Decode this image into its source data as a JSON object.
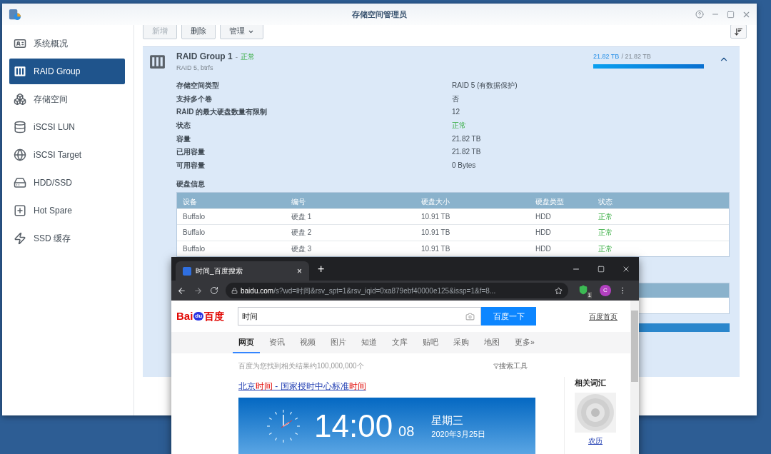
{
  "dsm_window": {
    "title": "存储空间管理员"
  },
  "sidebar": {
    "items": [
      {
        "label": "系统概况",
        "selected": false
      },
      {
        "label": "RAID Group",
        "selected": true
      },
      {
        "label": "存储空间",
        "selected": false
      },
      {
        "label": "iSCSI LUN",
        "selected": false
      },
      {
        "label": "iSCSI Target",
        "selected": false
      },
      {
        "label": "HDD/SSD",
        "selected": false
      },
      {
        "label": "Hot Spare",
        "selected": false
      },
      {
        "label": "SSD 缓存",
        "selected": false
      }
    ]
  },
  "toolbar": {
    "buttons": [
      {
        "label": "新增",
        "disabled": true,
        "kind": "plain"
      },
      {
        "label": "删除",
        "disabled": false,
        "kind": "plain"
      },
      {
        "label": "管理",
        "disabled": false,
        "kind": "dropdown"
      }
    ]
  },
  "raid_group": {
    "name": "RAID Group 1",
    "separator": "-",
    "status": "正常",
    "subtitle": "RAID 5, btrfs",
    "used": "21.82 TB",
    "total": "/ 21.82 TB",
    "usage": {
      "level": 1.0
    },
    "expanded": true,
    "details": [
      {
        "label": "存储空间类型",
        "value": "RAID 5 (有数据保护)",
        "kind": "text"
      },
      {
        "label": "支持多个卷",
        "value": "否",
        "kind": "text"
      },
      {
        "label": "RAID 的最大硬盘数量有限制",
        "value": "12",
        "kind": "text"
      },
      {
        "label": "状态",
        "value": "正常",
        "kind": "status"
      },
      {
        "label": "容量",
        "value": "21.82 TB",
        "kind": "text"
      },
      {
        "label": "已用容量",
        "value": "21.82 TB",
        "kind": "text"
      },
      {
        "label": "可用容量",
        "value": "0 Bytes",
        "kind": "text"
      }
    ],
    "disk_info": {
      "title": "硬盘信息",
      "columns": [
        "设备",
        "编号",
        "硬盘大小",
        "硬盘类型",
        "状态"
      ],
      "rows": [
        {
          "device": "Buffalo",
          "number": "硬盘 1",
          "size": "10.91 TB",
          "type": "HDD",
          "status": "正常"
        },
        {
          "device": "Buffalo",
          "number": "硬盘 2",
          "size": "10.91 TB",
          "type": "HDD",
          "status": "正常"
        },
        {
          "device": "Buffalo",
          "number": "硬盘 3",
          "size": "10.91 TB",
          "type": "HDD",
          "status": "正常"
        }
      ]
    }
  },
  "browser": {
    "tab": {
      "title": "时间_百度搜索",
      "close": "×"
    },
    "new_tab": "+",
    "url_host": "baidu.com",
    "url_rest": "/s?wd=时间&rsv_spt=1&rsv_iqid=0xa879ebf40000e125&issp=1&f=8...",
    "extension_badge": "1",
    "avatar": "C",
    "page": {
      "logo": {
        "left": "Bai",
        "paw": "du",
        "right": "百度"
      },
      "query": "时间",
      "search_button": "百度一下",
      "home_link": "百度首页",
      "nav": [
        {
          "label": "网页",
          "selected": true
        },
        {
          "label": "资讯",
          "selected": false
        },
        {
          "label": "视频",
          "selected": false
        },
        {
          "label": "图片",
          "selected": false
        },
        {
          "label": "知道",
          "selected": false
        },
        {
          "label": "文库",
          "selected": false
        },
        {
          "label": "贴吧",
          "selected": false
        },
        {
          "label": "采购",
          "selected": false
        },
        {
          "label": "地图",
          "selected": false
        },
        {
          "label": "更多»",
          "selected": false
        }
      ],
      "result_count": "百度为您找到相关结果约100,000,000个",
      "search_tools": "搜索工具",
      "result_title": [
        {
          "text": "北京",
          "highlight": false
        },
        {
          "text": "时间",
          "highlight": true
        },
        {
          "text": " - 国家授时中心标准",
          "highlight": false
        },
        {
          "text": "时间",
          "highlight": true
        }
      ],
      "clock": {
        "time": "14:00",
        "seconds": "08",
        "weekday": "星期三",
        "date": "2020年3月25日"
      },
      "related": {
        "title": "相关词汇",
        "items": [
          {
            "label": "农历"
          }
        ]
      }
    }
  }
}
